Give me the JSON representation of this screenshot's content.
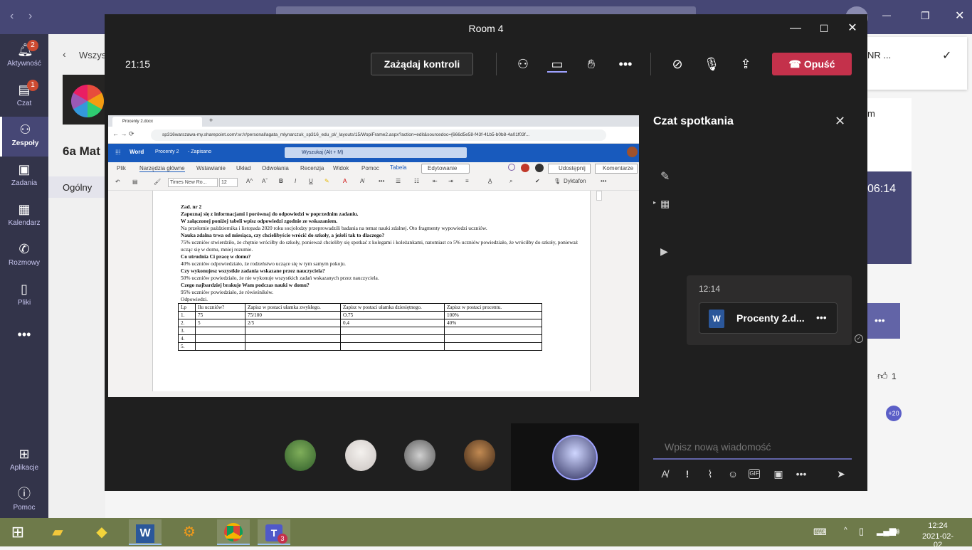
{
  "teams": {
    "rail": [
      {
        "label": "Aktywność",
        "badge": "2",
        "icon": "bell-icon"
      },
      {
        "label": "Czat",
        "badge": "1",
        "icon": "chat-icon"
      },
      {
        "label": "Zespoły",
        "badge": "",
        "icon": "teams-icon"
      },
      {
        "label": "Zadania",
        "badge": "",
        "icon": "assignments-icon"
      },
      {
        "label": "Kalendarz",
        "badge": "",
        "icon": "calendar-icon"
      },
      {
        "label": "Rozmowy",
        "badge": "",
        "icon": "phone-icon"
      },
      {
        "label": "Pliki",
        "badge": "",
        "icon": "files-icon"
      },
      {
        "label": "Aplikacje",
        "badge": "",
        "icon": "apps-icon"
      },
      {
        "label": "Pomoc",
        "badge": "",
        "icon": "help-icon"
      }
    ],
    "back_label": "Wszys",
    "team_name": "6a Mat",
    "channel": "Ogólny",
    "right_snippets": {
      "nr": "NR ...",
      "m": "m",
      "time": "06:14",
      "reaction_count": "1",
      "plus": "+20"
    }
  },
  "meeting": {
    "title": "Room 4",
    "timer": "21:15",
    "request_control": "Zażądaj kontroli",
    "leave": "Opuść"
  },
  "shared": {
    "tab_title": "Procenty 2.docx",
    "url": "sp316warszawa-my.sharepoint.com/:w:/r/personal/agata_mlynarczuk_sp316_edu_pl/_layouts/15/WopiFrame2.aspx?action=edit&sourcedoc={666d5e58-f43f-41b5-b0b8-4a01f03f...",
    "app": "Word",
    "doc_name": "Procenty 2",
    "doc_status": "- Zapisano",
    "search": "Wyszukaj (Alt + M)",
    "ribbon_tabs": [
      "Plik",
      "Narzędzia główne",
      "Wstawianie",
      "Układ",
      "Odwołania",
      "Recenzja",
      "Widok",
      "Pomoc",
      "Tabela"
    ],
    "edit_mode": "Edytowanie",
    "share": "Udostępnij",
    "comments": "Komentarze",
    "font": "Times New Ro...",
    "size": "12",
    "dictate": "Dyktafon",
    "doc": {
      "title": "Zad. nr 2",
      "line1": "Zapoznaj się z informacjami i porównaj do odpowiedzi w poprzednim zadaniu.",
      "line2": "W załączonej poniżej tabeli wpisz odpowiedzi zgodnie ze wskazaniem.",
      "line3": "Na przełomie października i listopada 2020 roku socjolodzy przeprowadzili badania na temat nauki zdalnej. Oto fragmenty wypowiedzi uczniów.",
      "q1": "Nauka zdalna trwa od miesiąca, czy chcielibyście wrócić do szkoły, a jeżeli tak to dlaczego?",
      "a1": "75% uczniów stwierdziło, że chętnie wróciłby do szkoły, ponieważ chcieliby się spotkać z kolegami i koleżankami, natomiast co 5% uczniów powiedziało, że wróciłby do szkoły, ponieważ ucząc się w domu, mniej rozumie.",
      "q2": "Co utrudnia Ci pracę w domu?",
      "a2": "40% uczniów odpowiedziało, że rodzeństwo uczące się w tym samym pokoju.",
      "q3": "Czy wykonujesz wszystkie zadania wskazane przez nauczyciela?",
      "a3": "50% uczniów powiedziało, że  nie wykonuje  wszystkich zadań wskazanych przez nauczyciela.",
      "q4": "Czego najbardziej brakuje Wam podczas nauki w domu?",
      "a4": "95% uczniów powiedziało, że rówieśników.",
      "answer": "Odpowiedzi.",
      "table_headers": [
        "Lp",
        "Ilu uczniów?",
        "Zapisz w postaci ułamka zwykłego.",
        "Zapisz w postaci ułamka dziesiętnego.",
        "Zapisz w postaci procentu."
      ],
      "table_rows": [
        [
          "1.",
          "75",
          "75/100",
          "O.75",
          "100%"
        ],
        [
          "2.",
          "5",
          "2/5",
          "0,4",
          "40%"
        ],
        [
          "3.",
          "",
          "",
          "",
          ""
        ],
        [
          "4.",
          "",
          "",
          "",
          ""
        ],
        [
          "5.",
          "",
          "",
          "",
          ""
        ]
      ]
    }
  },
  "chat": {
    "title": "Czat spotkania",
    "msg_time": "12:14",
    "file_name": "Procenty 2.d...",
    "placeholder": "Wpisz nową wiadomość"
  },
  "taskbar": {
    "time": "12:24",
    "date": "2021-02-02",
    "teams_badge": "3"
  }
}
